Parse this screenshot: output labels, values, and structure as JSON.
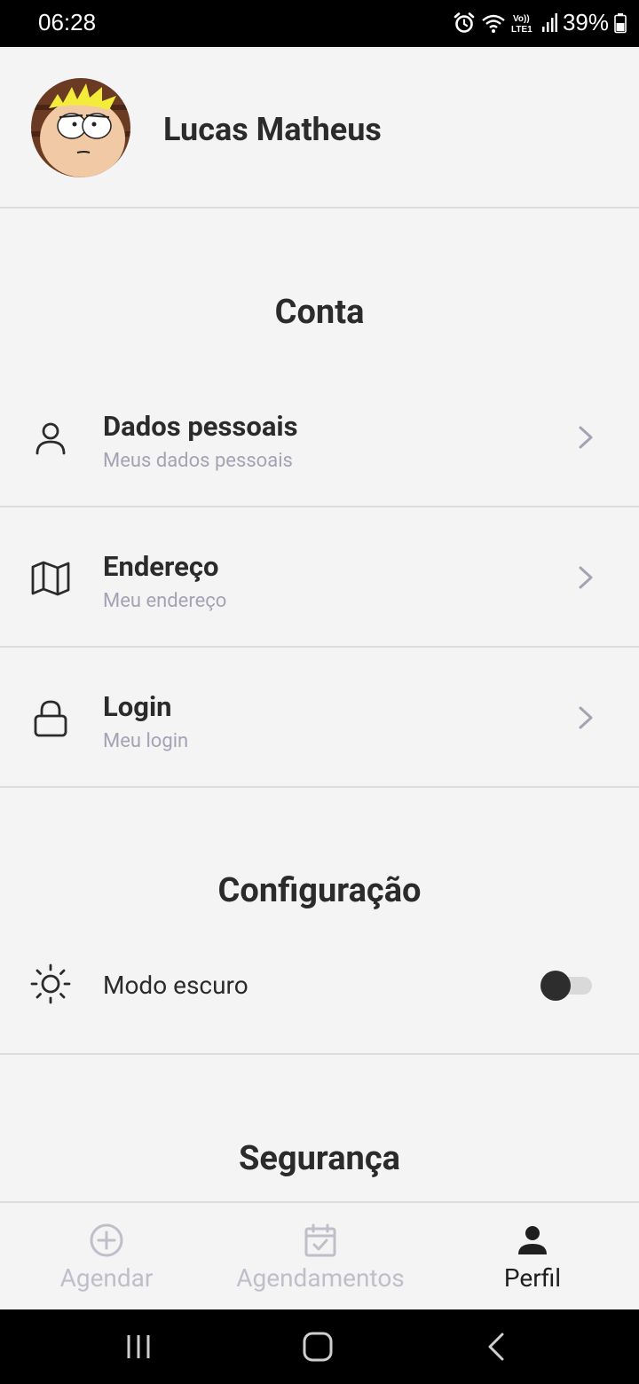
{
  "status_bar": {
    "time": "06:28",
    "battery_percent": "39%",
    "icons": [
      "alarm-icon",
      "wifi-icon",
      "volte-icon",
      "signal-icon",
      "battery-icon"
    ]
  },
  "profile": {
    "name": "Lucas Matheus",
    "avatar": "avatar-image"
  },
  "sections": {
    "account_title": "Conta",
    "config_title": "Configuração",
    "security_title": "Segurança"
  },
  "account_items": [
    {
      "title": "Dados pessoais",
      "subtitle": "Meus dados pessoais",
      "icon": "user-icon"
    },
    {
      "title": "Endereço",
      "subtitle": "Meu endereço",
      "icon": "map-icon"
    },
    {
      "title": "Login",
      "subtitle": "Meu login",
      "icon": "lock-icon"
    }
  ],
  "settings": {
    "dark_mode_label": "Modo escuro",
    "dark_mode_enabled": false,
    "icon": "sun-icon"
  },
  "bottom_nav": {
    "items": [
      {
        "label": "Agendar",
        "icon": "plus-circle-icon",
        "active": false
      },
      {
        "label": "Agendamentos",
        "icon": "calendar-check-icon",
        "active": false
      },
      {
        "label": "Perfil",
        "icon": "person-icon",
        "active": true
      }
    ]
  },
  "colors": {
    "background": "#f4f4f4",
    "text": "#2b2b2b",
    "subtitle": "#a5a3b3",
    "inactive_nav": "#c0bfc9",
    "divider": "#dcdcdc"
  }
}
